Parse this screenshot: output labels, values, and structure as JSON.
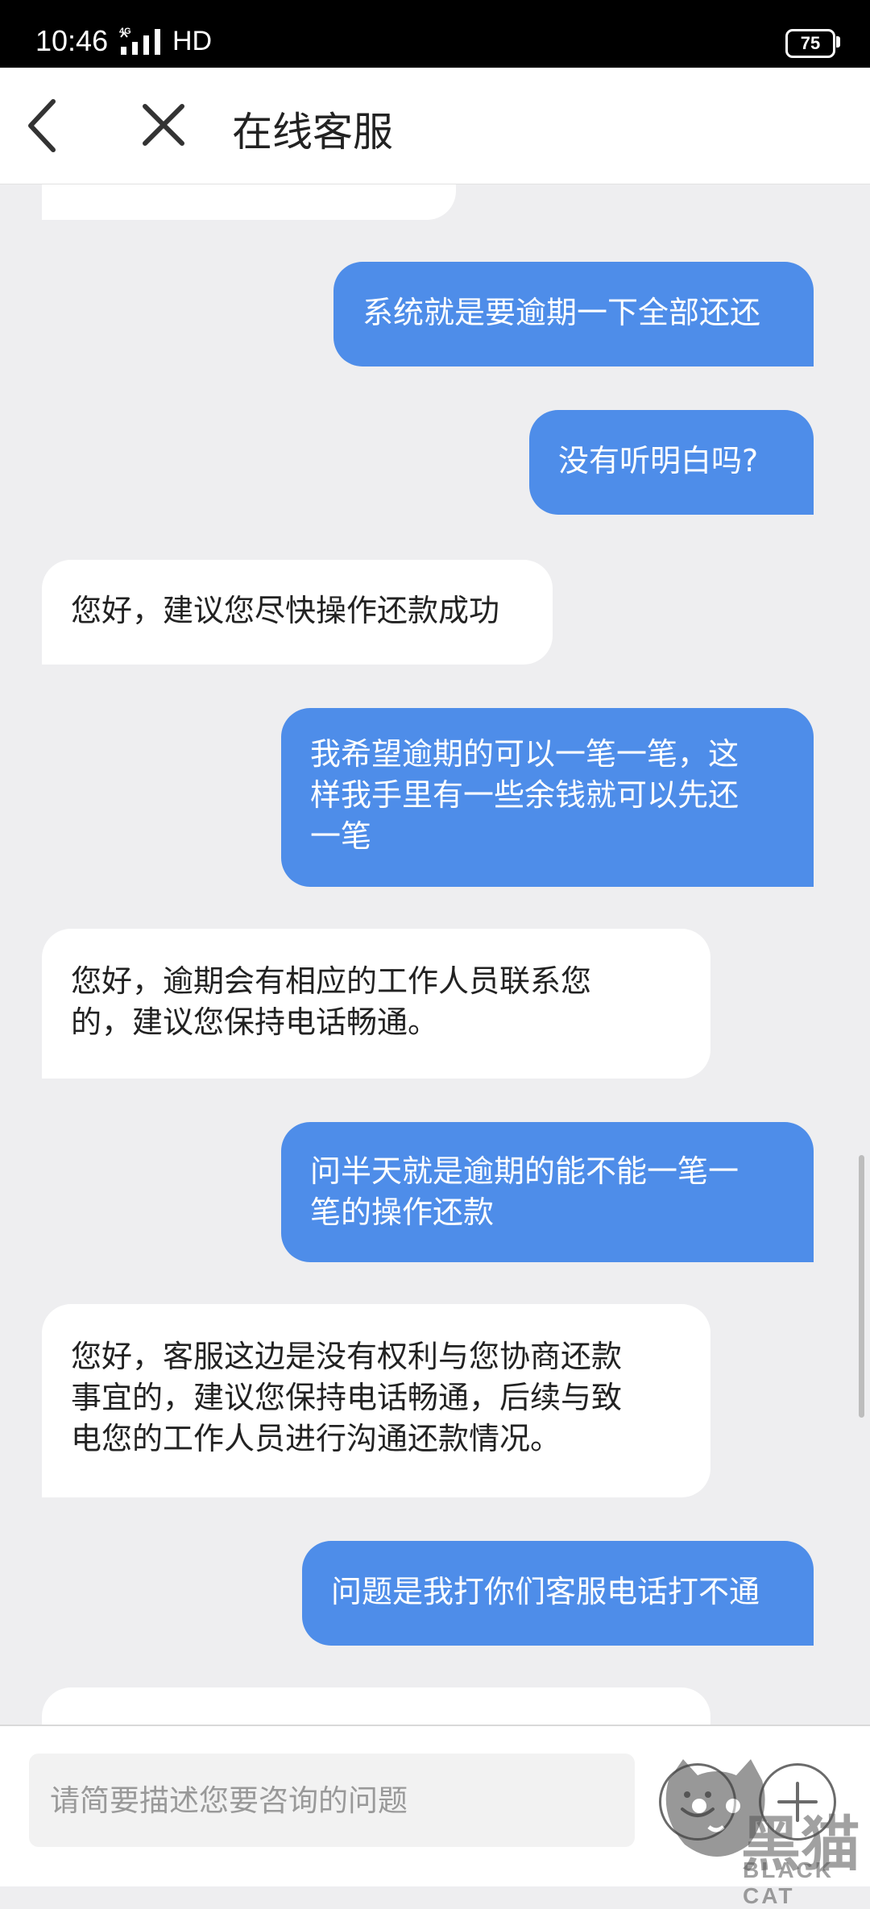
{
  "status_bar": {
    "time": "10:46",
    "network": "4G",
    "hd_label": "HD",
    "battery": "75"
  },
  "header": {
    "title": "在线客服"
  },
  "input": {
    "placeholder": "请简要描述您要咨询的问题"
  },
  "watermark": {
    "text": "黑猫",
    "subtext": "BLACK CAT"
  },
  "colors": {
    "user_bubble": "#4e8de9",
    "agent_bubble": "#ffffff",
    "chat_background": "#eeeef0"
  },
  "messages": [
    {
      "sender": "agent",
      "lines": [
        ""
      ]
    },
    {
      "sender": "user",
      "lines": [
        "系统就是要逾期一下全部还还"
      ]
    },
    {
      "sender": "user",
      "lines": [
        "没有听明白吗?"
      ]
    },
    {
      "sender": "agent",
      "lines": [
        "您好，建议您尽快操作还款成功"
      ]
    },
    {
      "sender": "user",
      "lines": [
        "我希望逾期的可以一笔一笔，这",
        "样我手里有一些余钱就可以先还",
        "一笔"
      ]
    },
    {
      "sender": "agent",
      "lines": [
        "您好，逾期会有相应的工作人员联系您",
        "的，建议您保持电话畅通。"
      ]
    },
    {
      "sender": "user",
      "lines": [
        "问半天就是逾期的能不能一笔一",
        "笔的操作还款"
      ]
    },
    {
      "sender": "agent",
      "lines": [
        "您好，客服这边是没有权利与您协商还款",
        "事宜的，建议您保持电话畅通，后续与致",
        "电您的工作人员进行沟通还款情况。"
      ]
    },
    {
      "sender": "user",
      "lines": [
        "问题是我打你们客服电话打不通"
      ]
    },
    {
      "sender": "agent",
      "lines": [
        ""
      ]
    }
  ]
}
